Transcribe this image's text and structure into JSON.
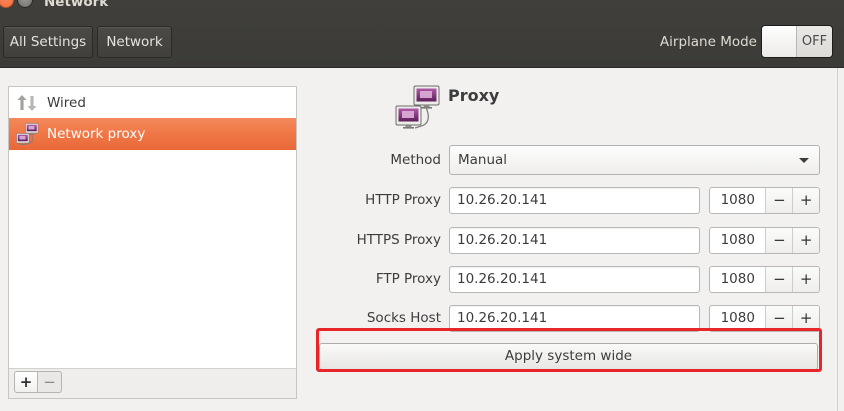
{
  "window": {
    "title": "Network",
    "controls": [
      "close-icon",
      "minimize-icon"
    ]
  },
  "header": {
    "all_settings_label": "All Settings",
    "network_label": "Network",
    "airplane_mode": {
      "label": "Airplane Mode",
      "state": "OFF"
    }
  },
  "sidebar": {
    "items": [
      {
        "label": "Wired",
        "icon": "wired-arrows-icon",
        "selected": false
      },
      {
        "label": "Network proxy",
        "icon": "network-proxy-icon",
        "selected": true
      }
    ],
    "add_label": "+",
    "remove_label": "−"
  },
  "proxy": {
    "title": "Proxy",
    "icon": "proxy-monitors-icon",
    "method": {
      "label": "Method",
      "value": "Manual"
    },
    "spin_decrement": "−",
    "spin_increment": "+",
    "rows": [
      {
        "label": "HTTP Proxy",
        "host": "10.26.20.141",
        "port": "1080"
      },
      {
        "label": "HTTPS Proxy",
        "host": "10.26.20.141",
        "port": "1080"
      },
      {
        "label": "FTP Proxy",
        "host": "10.26.20.141",
        "port": "1080"
      },
      {
        "label": "Socks Host",
        "host": "10.26.20.141",
        "port": "1080"
      }
    ],
    "apply_label": "Apply system wide"
  },
  "colors": {
    "accent": "#f07746",
    "highlight_box": "#e8262a",
    "header_bg": "#3c3b37",
    "close_button": "#f46d3e"
  }
}
